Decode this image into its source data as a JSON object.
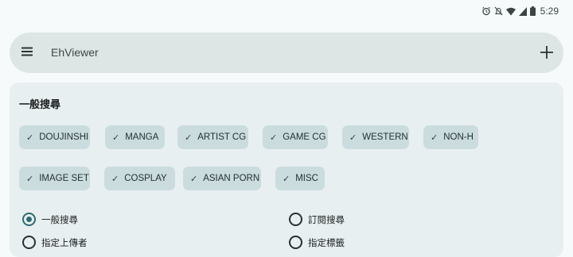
{
  "status_bar": {
    "time": "5:29",
    "icons": [
      "alarm-icon",
      "mute-icon",
      "wifi-icon",
      "signal-icon",
      "battery-icon"
    ]
  },
  "search": {
    "placeholder": "EhViewer"
  },
  "panel": {
    "title": "一般搜尋",
    "categories": [
      {
        "label": "DOUJINSHI",
        "checked": true
      },
      {
        "label": "MANGA",
        "checked": true
      },
      {
        "label": "ARTIST CG",
        "checked": true
      },
      {
        "label": "GAME CG",
        "checked": true
      },
      {
        "label": "WESTERN",
        "checked": true
      },
      {
        "label": "NON-H",
        "checked": true
      },
      {
        "label": "IMAGE SET",
        "checked": true
      },
      {
        "label": "COSPLAY",
        "checked": true
      },
      {
        "label": "ASIAN PORN",
        "checked": true
      },
      {
        "label": "MISC",
        "checked": true
      }
    ],
    "check_glyph": "✓",
    "search_modes": [
      {
        "label": "一般搜尋",
        "selected": true
      },
      {
        "label": "訂閱搜尋",
        "selected": false
      },
      {
        "label": "指定上傳者",
        "selected": false
      },
      {
        "label": "指定標籤",
        "selected": false
      }
    ]
  },
  "colors": {
    "background": "#f6fafa",
    "search_bar": "#dde5e5",
    "panel": "#e8eff0",
    "chip": "#cbdcdf",
    "accent": "#2e6b71"
  }
}
